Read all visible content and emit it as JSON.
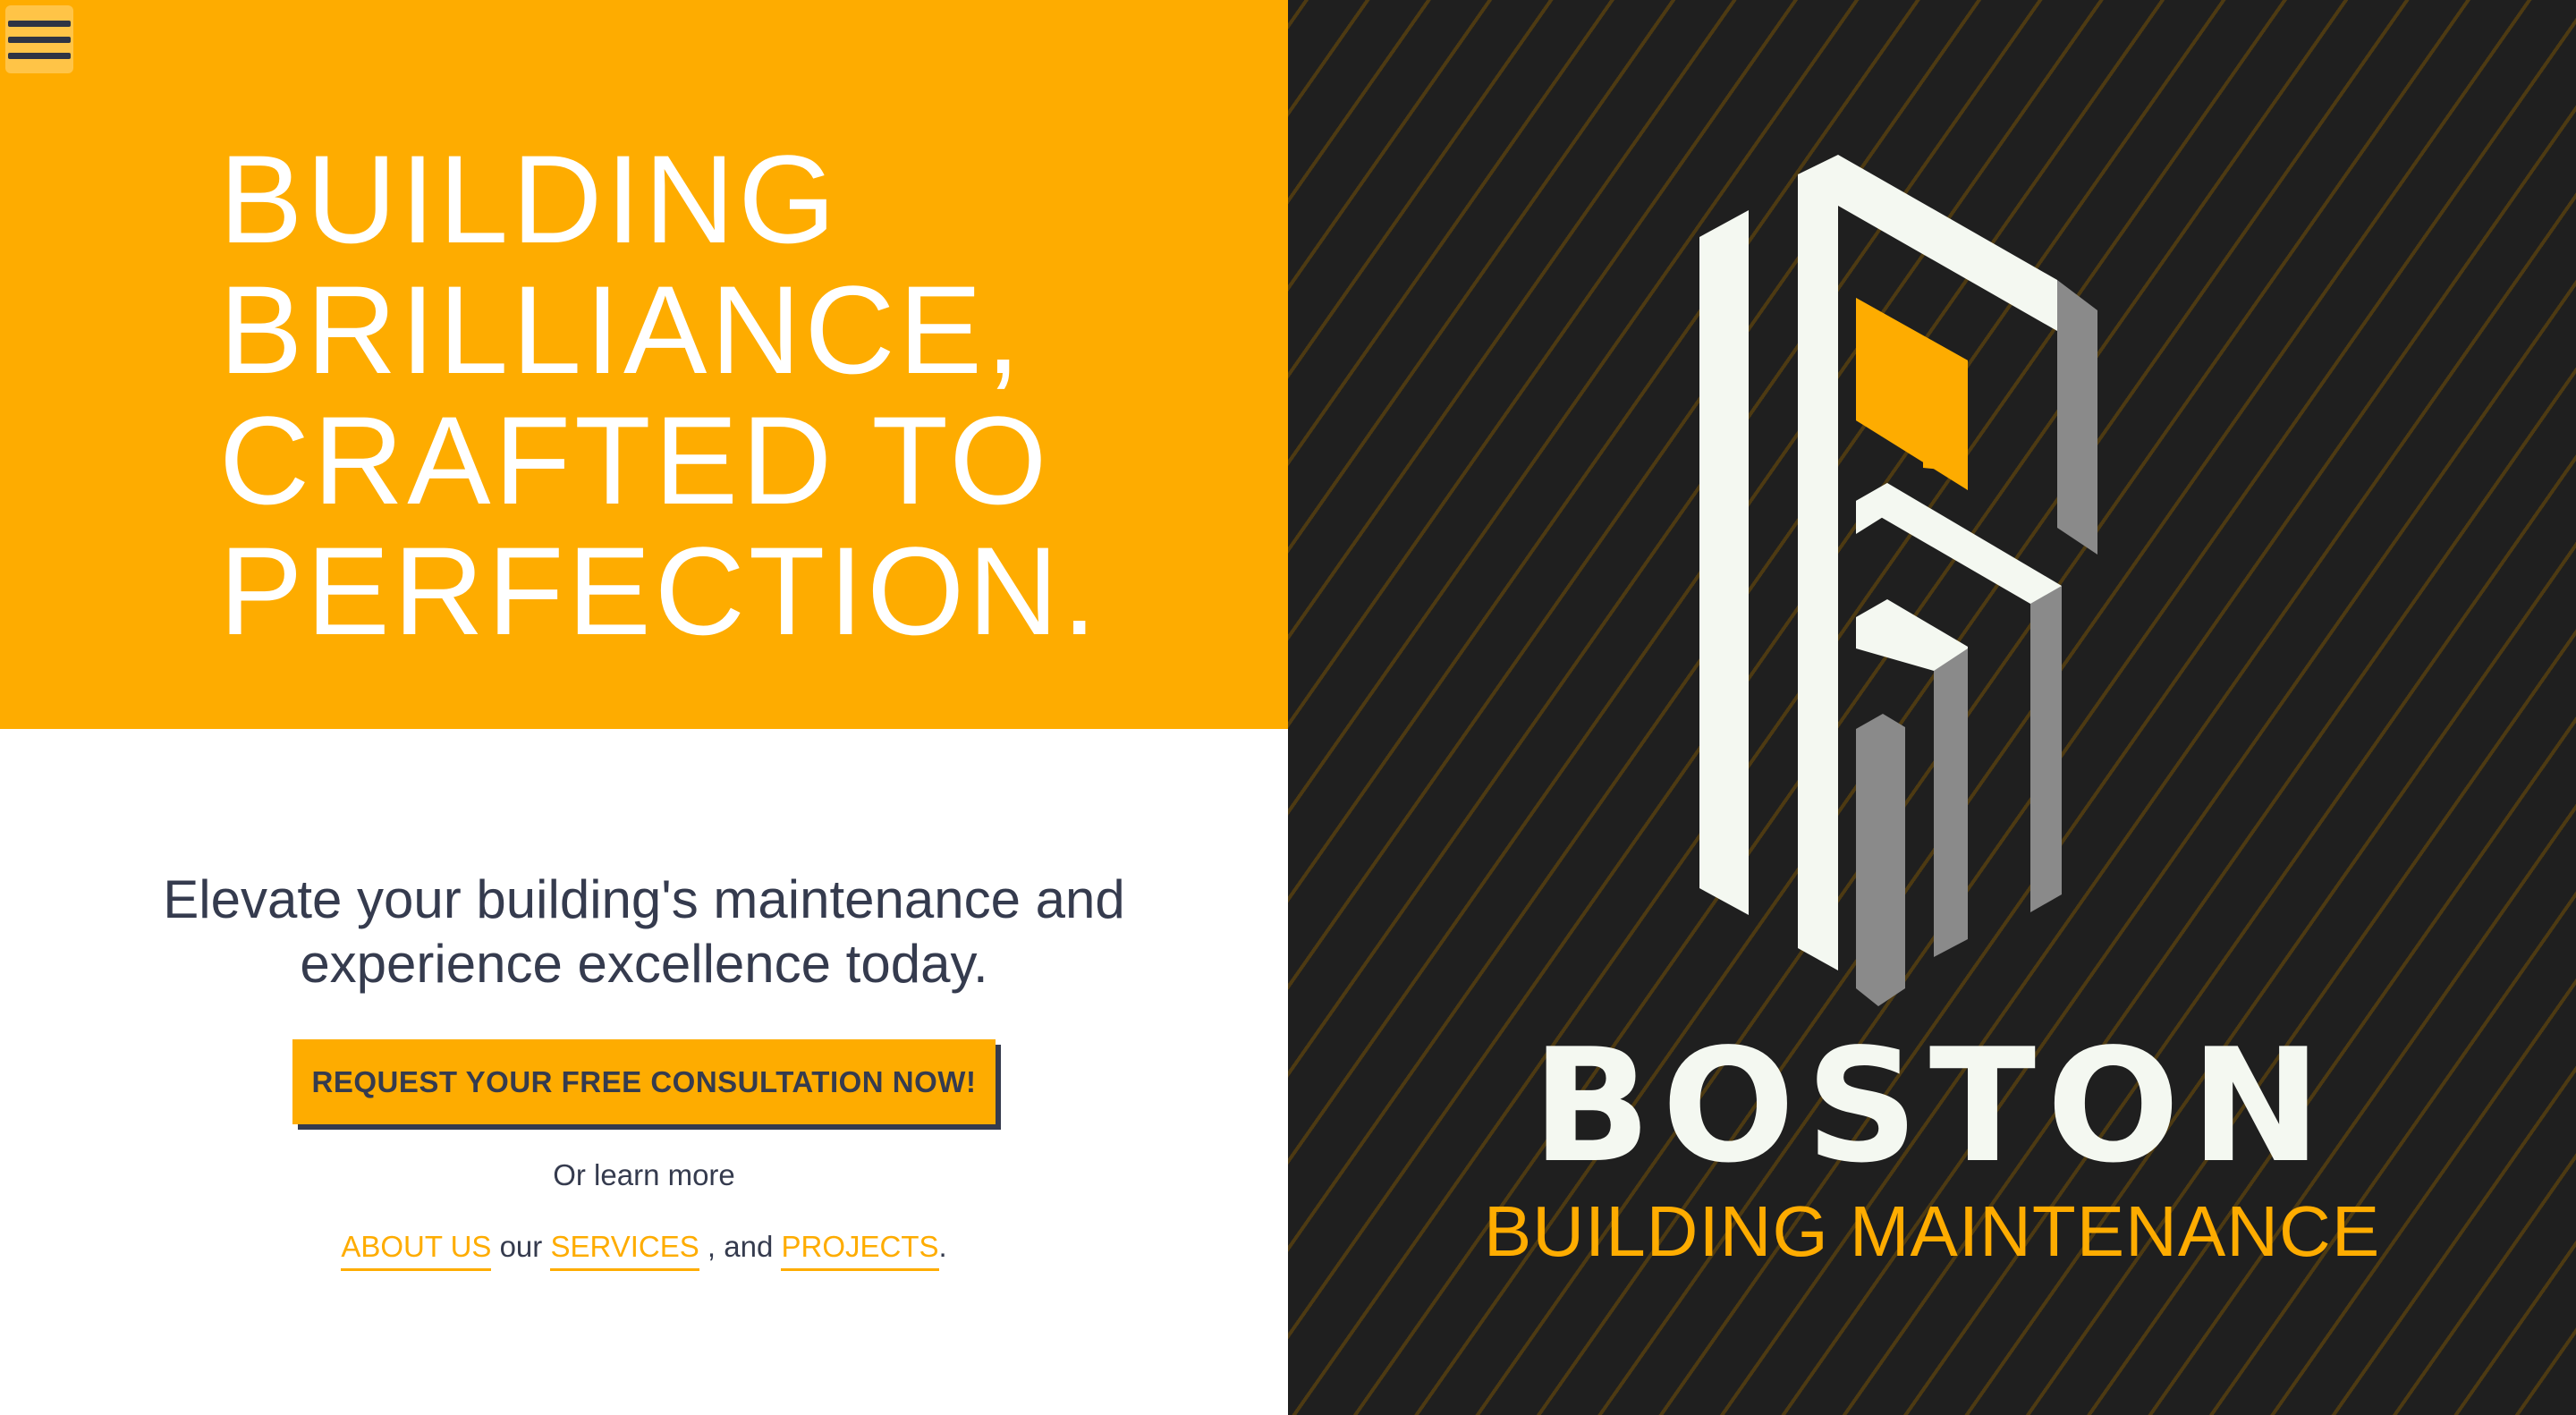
{
  "menu": {
    "icon": "hamburger-menu-icon"
  },
  "hero": {
    "headline_lines": [
      "BUILDING",
      "BRILLIANCE,",
      "CRAFTED TO",
      "PERFECTION."
    ]
  },
  "intro": {
    "tagline_lines": [
      "Elevate your building's maintenance and",
      "experience excellence today."
    ],
    "cta_label": "REQUEST YOUR FREE CONSULTATION NOW!",
    "learn_more": "Or learn more",
    "links": {
      "about": "ABOUT US",
      "between_1": " our ",
      "services": "SERVICES",
      "between_2": " , and ",
      "projects": "PROJECTS",
      "end": "."
    }
  },
  "brand": {
    "logo_icon": "building-logo-icon",
    "name": "BOSTON",
    "subtitle": "BUILDING MAINTENANCE"
  },
  "colors": {
    "accent": "#feac00",
    "dark": "#1f1f1f",
    "text_dark": "#353b4e",
    "logo_white": "#f4f8f1",
    "logo_gray": "#8a8a8a"
  }
}
